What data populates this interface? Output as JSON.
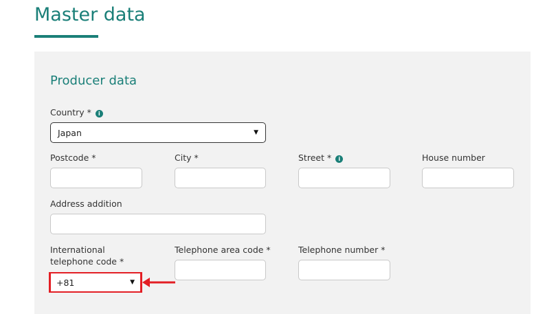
{
  "page": {
    "title": "Master data"
  },
  "section": {
    "title": "Producer data"
  },
  "country": {
    "label": "Country *",
    "value": "Japan",
    "info_icon": "info-icon"
  },
  "postcode": {
    "label": "Postcode *",
    "value": ""
  },
  "city": {
    "label": "City *",
    "value": ""
  },
  "street": {
    "label": "Street *",
    "value": "",
    "info_icon": "info-icon"
  },
  "house_number": {
    "label": "House number",
    "value": ""
  },
  "address_addition": {
    "label": "Address addition",
    "value": ""
  },
  "intl_code": {
    "label_line1": "International",
    "label_line2": "telephone code *",
    "value": "+81"
  },
  "area_code": {
    "label": "Telephone area code *",
    "value": ""
  },
  "phone_number": {
    "label": "Telephone number *",
    "value": ""
  },
  "colors": {
    "accent": "#1a7f78",
    "highlight": "#e31e24",
    "panel": "#f2f2f2"
  }
}
